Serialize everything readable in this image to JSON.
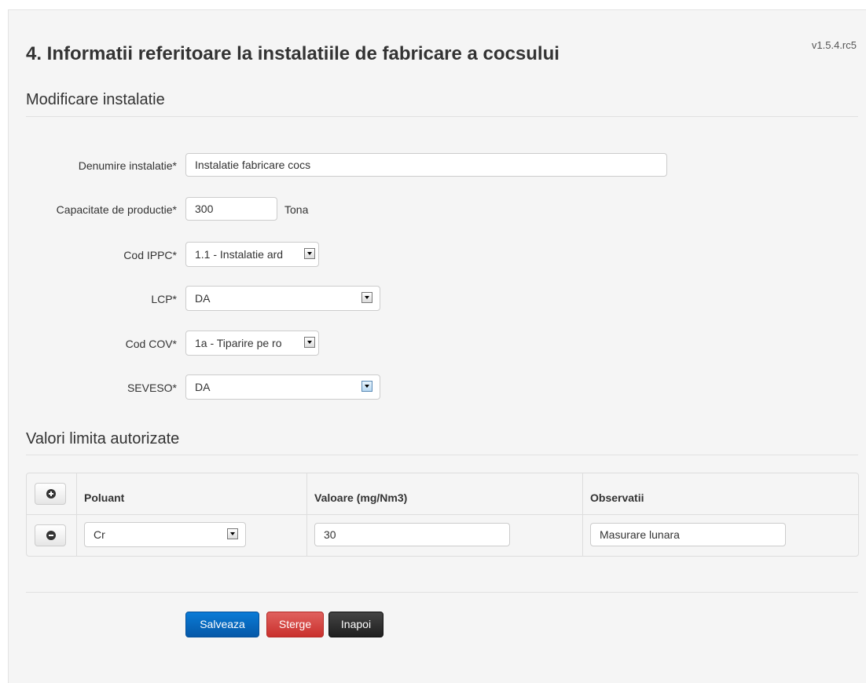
{
  "version": "v1.5.4.rc5",
  "page_title": "4. Informatii referitoare la instalatiile de fabricare a cocsului",
  "section_edit": "Modificare instalatie",
  "form": {
    "name": {
      "label": "Denumire instalatie*",
      "value": "Instalatie fabricare cocs"
    },
    "capacity": {
      "label": "Capacitate de productie*",
      "value": "300",
      "unit": "Tona"
    },
    "ippc": {
      "label": "Cod IPPC*",
      "value": "1.1 - Instalatie ard"
    },
    "lcp": {
      "label": "LCP*",
      "value": "DA"
    },
    "cov": {
      "label": "Cod COV*",
      "value": "1a - Tiparire pe ro"
    },
    "seveso": {
      "label": "SEVESO*",
      "value": "DA"
    }
  },
  "section_limits": "Valori limita autorizate",
  "table": {
    "headers": {
      "pollutant": "Poluant",
      "value": "Valoare (mg/Nm3)",
      "notes": "Observatii"
    },
    "rows": [
      {
        "pollutant": "Cr",
        "value": "30",
        "notes": "Masurare lunara"
      }
    ]
  },
  "buttons": {
    "save": "Salveaza",
    "delete": "Sterge",
    "back": "Inapoi"
  },
  "icons": {
    "add_row": "plus-circle-icon",
    "remove_row": "minus-circle-icon",
    "dropdown": "chevron-down-icon"
  }
}
